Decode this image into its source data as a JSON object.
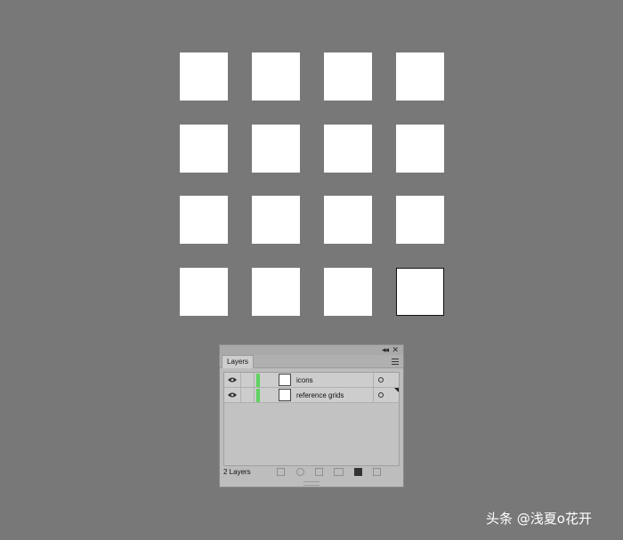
{
  "canvas": {
    "background": "#787878",
    "grid": {
      "rows": 4,
      "cols": 4,
      "selected_index": 15,
      "square_color": "#ffffff"
    }
  },
  "layers_panel": {
    "tab_label": "Layers",
    "collapse_glyph": "◂◂",
    "close_glyph": "✕",
    "menu_icon": "hamburger-menu-icon",
    "layers": [
      {
        "name": "icons",
        "color": "#5fd35f",
        "visible": true
      },
      {
        "name": "reference grids",
        "color": "#5fd35f",
        "visible": true
      }
    ],
    "footer": {
      "count_label": "2 Layers",
      "tools": [
        "export-icon",
        "locate-object-icon",
        "make-clipping-mask-icon",
        "create-sublayer-icon",
        "new-layer-icon",
        "delete-icon"
      ]
    }
  },
  "watermark": "头条 @浅夏o花开"
}
